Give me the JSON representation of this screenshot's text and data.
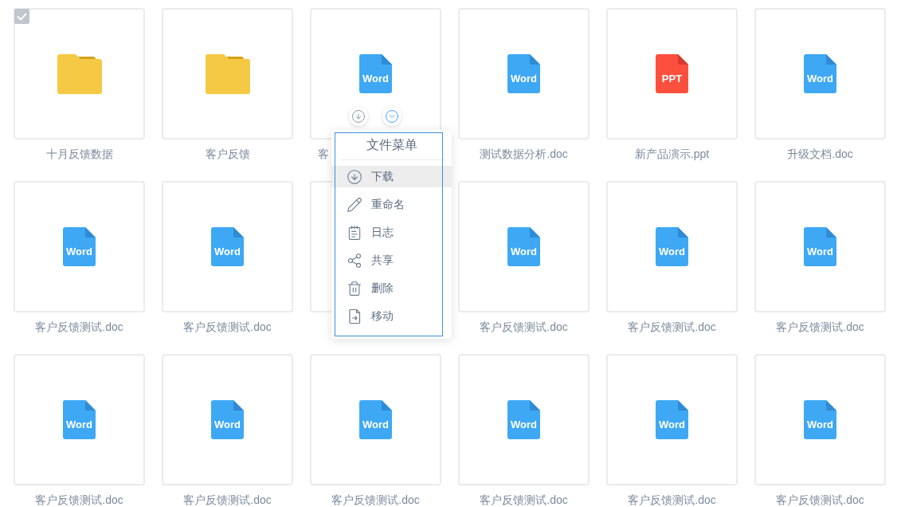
{
  "files": [
    {
      "kind": "folder",
      "label": "十月反馈数据",
      "checked": true,
      "hovered": false
    },
    {
      "kind": "folder",
      "label": "客户反馈",
      "checked": false,
      "hovered": false
    },
    {
      "kind": "word",
      "icon_text": "Word",
      "label": "客",
      "checked": false,
      "hovered": true,
      "menu": {
        "title": "文件菜单",
        "items": [
          {
            "label": "下载",
            "selected": true
          },
          {
            "label": "重命名",
            "selected": false
          },
          {
            "label": "日志",
            "selected": false
          },
          {
            "label": "共享",
            "selected": false
          },
          {
            "label": "删除",
            "selected": false
          },
          {
            "label": "移动",
            "selected": false
          }
        ]
      }
    },
    {
      "kind": "word",
      "icon_text": "Word",
      "label": "测试数据分析.doc",
      "checked": false,
      "hovered": false
    },
    {
      "kind": "ppt",
      "icon_text": "PPT",
      "label": "新产品演示.ppt",
      "checked": false,
      "hovered": false
    },
    {
      "kind": "word",
      "icon_text": "Word",
      "label": "升级文档.doc",
      "checked": false,
      "hovered": false
    },
    {
      "kind": "word",
      "icon_text": "Word",
      "label": "客户反馈测试.doc",
      "checked": false,
      "hovered": false
    },
    {
      "kind": "word",
      "icon_text": "Word",
      "label": "客户反馈测试.doc",
      "checked": false,
      "hovered": false
    },
    {
      "checked": false,
      "hovered": false
    },
    {
      "kind": "word",
      "icon_text": "Word",
      "label": "客户反馈测试.doc",
      "checked": false,
      "hovered": false
    },
    {
      "kind": "word",
      "icon_text": "Word",
      "label": "客户反馈测试.doc",
      "checked": false,
      "hovered": false
    },
    {
      "kind": "word",
      "icon_text": "Word",
      "label": "客户反馈测试.doc",
      "checked": false,
      "hovered": false
    },
    {
      "kind": "word",
      "icon_text": "Word",
      "label": "客户反馈测试.doc",
      "checked": false,
      "hovered": false
    },
    {
      "kind": "word",
      "icon_text": "Word",
      "label": "客户反馈测试.doc",
      "checked": false,
      "hovered": false
    },
    {
      "kind": "word",
      "icon_text": "Word",
      "label": "客户反馈测试.doc",
      "checked": false,
      "hovered": false
    },
    {
      "kind": "word",
      "icon_text": "Word",
      "label": "客户反馈测试.doc",
      "checked": false,
      "hovered": false
    },
    {
      "kind": "word",
      "icon_text": "Word",
      "label": "客户反馈测试.doc",
      "checked": false,
      "hovered": false
    },
    {
      "kind": "word",
      "icon_text": "Word",
      "label": "客户反馈测试.doc",
      "checked": false,
      "hovered": false
    }
  ]
}
